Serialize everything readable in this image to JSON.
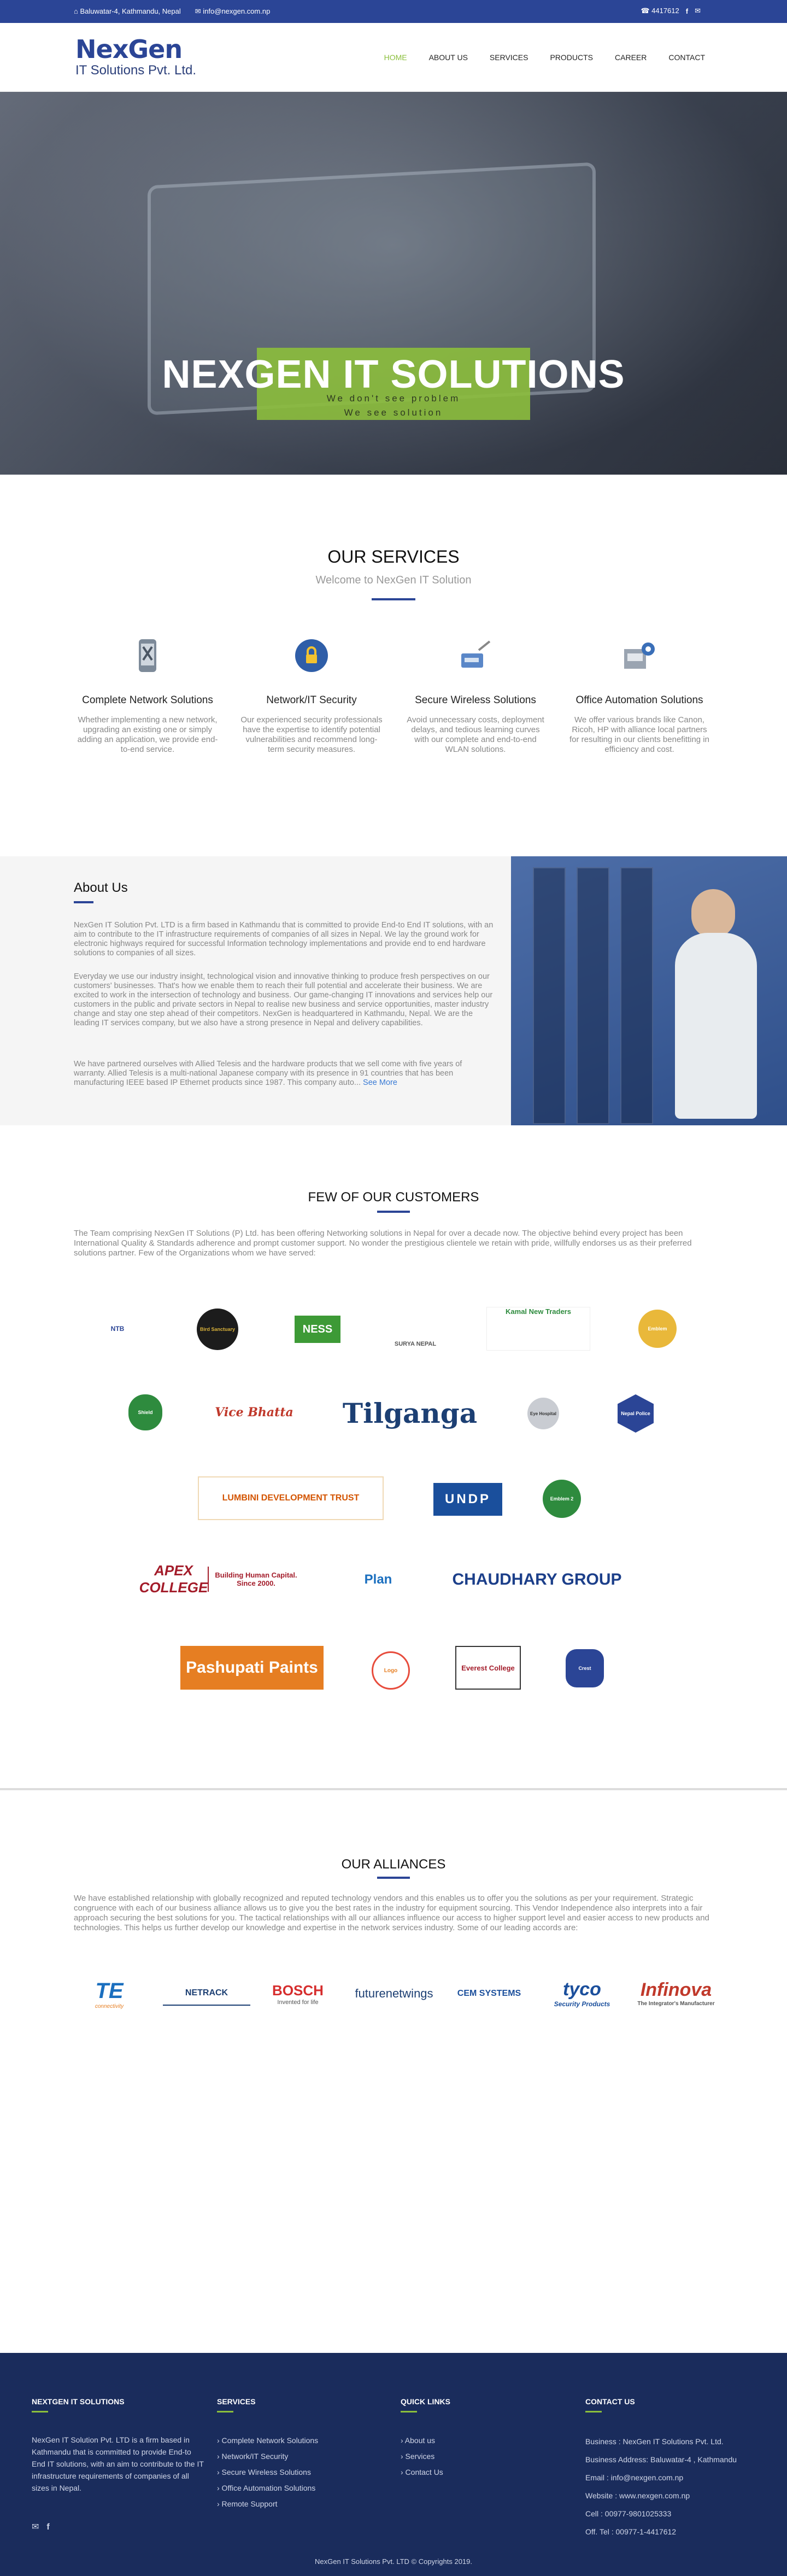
{
  "topbar": {
    "address": "Baluwatar-4, Kathmandu, Nepal",
    "email": "info@nexgen.com.np",
    "phone": "4417612"
  },
  "brand": {
    "name_line1": "NexGen",
    "name_line2": "IT Solutions Pvt. Ltd."
  },
  "nav": [
    "HOME",
    "ABOUT US",
    "SERVICES",
    "PRODUCTS",
    "CAREER",
    "CONTACT"
  ],
  "hero": {
    "title": "NEXGEN IT SOLUTIONS",
    "tag1": "We don't see problem",
    "tag2": "We see solution"
  },
  "services": {
    "title": "OUR SERVICES",
    "subtitle": "Welcome to NexGen IT Solution",
    "items": [
      {
        "title": "Complete Network Solutions",
        "text": "Whether implementing a new network, upgrading an existing one or simply adding an application, we provide end-to-end service."
      },
      {
        "title": "Network/IT Security",
        "text": "Our experienced security professionals have the expertise to identify potential vulnerabilities and recommend long-term security measures."
      },
      {
        "title": "Secure Wireless Solutions",
        "text": "Avoid unnecessary costs, deployment delays, and tedious learning curves with our complete and end-to-end WLAN solutions."
      },
      {
        "title": "Office Automation Solutions",
        "text": "We offer various brands like Canon, Ricoh, HP with alliance local partners for resulting in our clients benefitting in efficiency and cost."
      }
    ]
  },
  "about": {
    "title": "About Us",
    "p1": "NexGen IT Solution Pvt. LTD is a firm based in Kathmandu that is committed to provide End-to End IT solutions, with an aim to contribute to the IT infrastructure requirements of companies of all sizes in Nepal. We lay the ground work for electronic highways required for successful Information technology implementations and provide end to end hardware solutions to companies of all sizes.",
    "p2": "Everyday we use our industry insight, technological vision and innovative thinking to produce fresh perspectives on our customers' businesses. That's how we enable them to reach their full potential and accelerate their business. We are excited to work in the intersection of technology and business. Our game-changing IT innovations and services help our customers in the public and private sectors in Nepal to realise new business and service opportunities, master industry change and stay one step ahead of their competitors. NexGen is headquartered in Kathmandu, Nepal. We are the leading IT services company, but we also have a strong presence in Nepal and delivery capabilities.",
    "p3": "We have partnered ourselves with Allied Telesis and the hardware products that we sell come with five years of warranty. Allied Telesis is a multi-national Japanese company with its presence in 91 countries that has been manufacturing IEEE based IP Ethernet products since 1987. This company auto...",
    "more": "See More"
  },
  "customers": {
    "title": "FEW OF OUR CUSTOMERS",
    "text": "The Team comprising NexGen IT Solutions (P) Ltd. has been offering Networking solutions in Nepal for over a decade now. The objective behind every project has been International Quality & Standards adherence and prompt customer support. No wonder the prestigious clientele we retain with pride, willfully endorses us as their preferred solutions partner. Few of the Organizations whom we have served:",
    "logos": [
      "NTB",
      "Bird Sanctuary",
      "NESS",
      "SURYA NEPAL",
      "Kamal New Traders",
      "Emblem",
      "Shield",
      "Vice Bhatta",
      "Tilganga",
      "Eye Hospital",
      "Nepal Police",
      "LUMBINI DEVELOPMENT TRUST",
      "UNDP",
      "Emblem 2",
      "APEX COLLEGE",
      "Building Human Capital. Since 2000.",
      "Plan",
      "CHAUDHARY GROUP",
      "Pashupati Paints",
      "Logo",
      "Everest College",
      "Crest"
    ]
  },
  "alliances": {
    "title": "OUR ALLIANCES",
    "text": "We have established relationship with globally recognized and reputed technology vendors and this enables us to offer you the solutions as per your requirement. Strategic congruence with each of our business alliance allows us to give you the best rates in the industry for equipment sourcing. This Vendor Independence also interprets into a fair approach securing the best solutions for you. The tactical relationships with all our alliances influence our access to higher support level and easier access to new products and technologies. This helps us further develop our knowledge and expertise in the network services industry. Some of our leading accords are:",
    "logos": [
      "TE",
      "NETRACK",
      "BOSCH",
      "futurenetwings",
      "CEM SYSTEMS",
      "tyco",
      "Infinova"
    ],
    "subs": [
      "connectivity",
      "",
      "Invented for life",
      "",
      "",
      "Security Products",
      "The Integrator's Manufacturer"
    ]
  },
  "footer": {
    "col1_title": "NEXTGEN IT SOLUTIONS",
    "col1_text": "NexGen IT Solution Pvt. LTD is a firm based in Kathmandu that is committed to provide End-to End IT solutions, with an aim to contribute to the IT infrastructure requirements of companies of all sizes in Nepal.",
    "col2_title": "SERVICES",
    "col2_items": [
      "› Complete Network Solutions",
      "› Network/IT Security",
      "› Secure Wireless Solutions",
      "› Office Automation Solutions",
      "› Remote Support"
    ],
    "col3_title": "QUICK LINKS",
    "col3_items": [
      "› About us",
      "› Services",
      "› Contact Us"
    ],
    "col4_title": "CONTACT US",
    "col4_items": [
      "Business : NexGen IT Solutions Pvt. Ltd.",
      "Business Address: Baluwatar-4 , Kathmandu",
      "Email : info@nexgen.com.np",
      "Website : www.nexgen.com.np",
      "Cell : 00977-9801025333",
      "Off. Tel : 00977-1-4417612"
    ],
    "copyright": "NexGen IT Solutions Pvt. LTD © Copyrights 2019."
  }
}
